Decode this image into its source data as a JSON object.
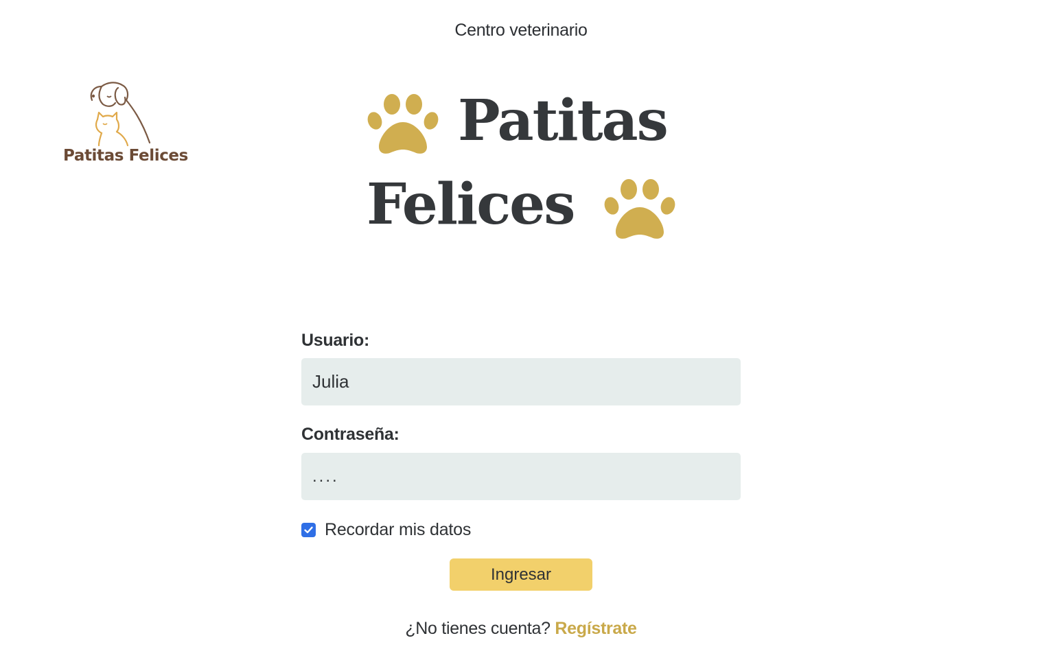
{
  "header": {
    "subtitle": "Centro veterinario"
  },
  "corner_logo": {
    "text": "Patitas Felices",
    "icon": "dog-and-cat-outline-icon"
  },
  "hero_logo": {
    "line1": "Patitas",
    "line2": "Felices",
    "icon": "paw-icon"
  },
  "form": {
    "username_label": "Usuario:",
    "username_value": "Julia",
    "password_label": "Contraseña:",
    "password_value": "....",
    "remember_label": "Recordar mis datos",
    "remember_checked": true,
    "submit_label": "Ingresar"
  },
  "footer": {
    "prompt": "¿No tienes cuenta?",
    "link_label": "Regístrate"
  },
  "colors": {
    "accent_gold": "#d0ae50",
    "button_yellow": "#f2d06b",
    "input_bg": "#e6edec",
    "logo_brown": "#6b4a35",
    "text_dark": "#2f3235",
    "checkbox_blue": "#2f6fe6"
  }
}
